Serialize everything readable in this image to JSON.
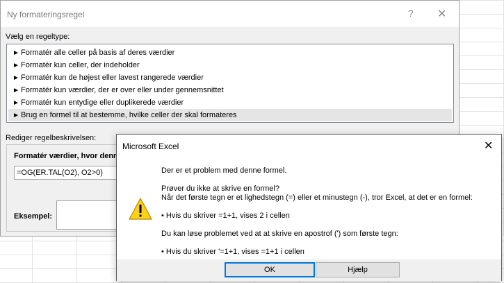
{
  "back_dialog": {
    "title": "Ny formateringsregel",
    "help_glyph": "?",
    "close_glyph": "✕",
    "rule_type_label": "Vælg en regeltype:",
    "rule_types": [
      "Formatér alle celler på basis af deres værdier",
      "Formatér kun celler, der indeholder",
      "Formatér kun de højest eller lavest rangerede værdier",
      "Formatér kun værdier, der er over eller under gennemsnittet",
      "Formatér kun entydige eller duplikerede værdier",
      "Brug en formel til at bestemme, hvilke celler der skal formateres"
    ],
    "selected_rule_index": 5,
    "rule_desc_label": "Rediger regelbeskrivelsen:",
    "desc_heading": "Formatér værdier, hvor denne",
    "formula_value": "=OG(ER.TAL(O2), O2>0)",
    "example_label": "Eksempel:"
  },
  "error_dialog": {
    "title": "Microsoft Excel",
    "close_glyph": "✕",
    "icon": "warning-icon",
    "messages": {
      "line1": "Der er et problem med denne formel.",
      "line2": "Prøver du ikke at skrive en formel?",
      "line3": "Når det første tegn er et lighedstegn (=) eller et minustegn (-), tror Excel, at det er en formel:",
      "line4": "• Hvis du skriver =1+1, vises 2 i cellen",
      "line5": "Du kan løse problemet ved at at skrive en apostrof (') som første tegn:",
      "line6": "• Hvis du skriver '=1+1, vises =1+1 i cellen"
    },
    "ok_label": "OK",
    "help_label": "Hjælp"
  },
  "colors": {
    "accent": "#0078d7",
    "warning_yellow": "#fcd116",
    "dialog_bg": "#f0f0f0"
  }
}
